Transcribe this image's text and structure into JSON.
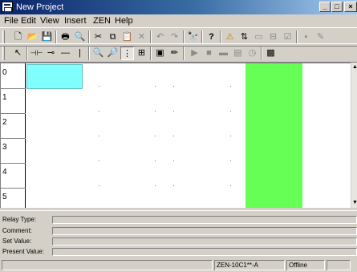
{
  "window": {
    "title": "New Project",
    "controls": {
      "minimize": "_",
      "maximize": "□",
      "close": "×"
    }
  },
  "menu": [
    "File",
    "Edit",
    "View",
    "Insert",
    "ZEN",
    "Help"
  ],
  "toolbar1": {
    "buttons": [
      {
        "name": "new-icon",
        "glyph": "🗋"
      },
      {
        "name": "open-folder-icon",
        "glyph": "📂"
      },
      {
        "name": "save-icon",
        "glyph": "💾"
      },
      {
        "name": "print-icon",
        "glyph": "🖶"
      },
      {
        "name": "print-preview-icon",
        "glyph": "🔍"
      },
      {
        "name": "cut-icon",
        "glyph": "✂"
      },
      {
        "name": "copy-icon",
        "glyph": "⧉"
      },
      {
        "name": "paste-icon",
        "glyph": "📋"
      },
      {
        "name": "delete-icon",
        "glyph": "✕"
      },
      {
        "name": "undo-icon",
        "glyph": "↶"
      },
      {
        "name": "redo-icon",
        "glyph": "↷"
      },
      {
        "name": "find-icon",
        "glyph": "🔭"
      },
      {
        "name": "help-icon",
        "glyph": "?"
      },
      {
        "name": "warning-icon",
        "glyph": "⚠"
      },
      {
        "name": "transfer-icon",
        "glyph": "⇅"
      },
      {
        "name": "monitor-icon",
        "glyph": "▭"
      },
      {
        "name": "compare-icon",
        "glyph": "⊟"
      },
      {
        "name": "check-icon",
        "glyph": "☑"
      },
      {
        "name": "io-set-icon",
        "glyph": "▪"
      },
      {
        "name": "edit-icon",
        "glyph": "✎"
      }
    ]
  },
  "toolbar2": {
    "buttons": [
      {
        "name": "select-pointer-icon",
        "glyph": "↖"
      },
      {
        "name": "contact-no-icon",
        "glyph": "⊣⊢"
      },
      {
        "name": "contact-nc-icon",
        "glyph": "⊸"
      },
      {
        "name": "horizontal-line-icon",
        "glyph": "—"
      },
      {
        "name": "vertical-line-icon",
        "glyph": "|"
      },
      {
        "name": "zoom-in-icon",
        "glyph": "🔍"
      },
      {
        "name": "zoom-out-icon",
        "glyph": "🔎"
      },
      {
        "name": "grid-icon",
        "glyph": "⋮"
      },
      {
        "name": "insert-line-icon",
        "glyph": "⊞"
      },
      {
        "name": "monitor-view-icon",
        "glyph": "▣"
      },
      {
        "name": "edit-mode-icon",
        "glyph": "✏"
      },
      {
        "name": "run-icon",
        "glyph": "▶"
      },
      {
        "name": "stop-icon",
        "glyph": "■"
      },
      {
        "name": "program-mode-icon",
        "glyph": "▬"
      },
      {
        "name": "io-monitor-icon",
        "glyph": "▤"
      },
      {
        "name": "timer-icon",
        "glyph": "◷"
      },
      {
        "name": "screen-icon",
        "glyph": "▩"
      }
    ]
  },
  "ladder": {
    "rungs": [
      "0",
      "1",
      "2",
      "3",
      "4",
      "5"
    ]
  },
  "info": {
    "relay_type": "Relay Type:",
    "comment": "Comment:",
    "set_value": "Set Value:",
    "present_value": "Present Value:"
  },
  "status": {
    "model": "ZEN-10C1**-A",
    "connection": "Offline"
  },
  "colors": {
    "cursor": "#80ffff",
    "active_column": "#66ff55",
    "titlebar": "#0a246a"
  }
}
